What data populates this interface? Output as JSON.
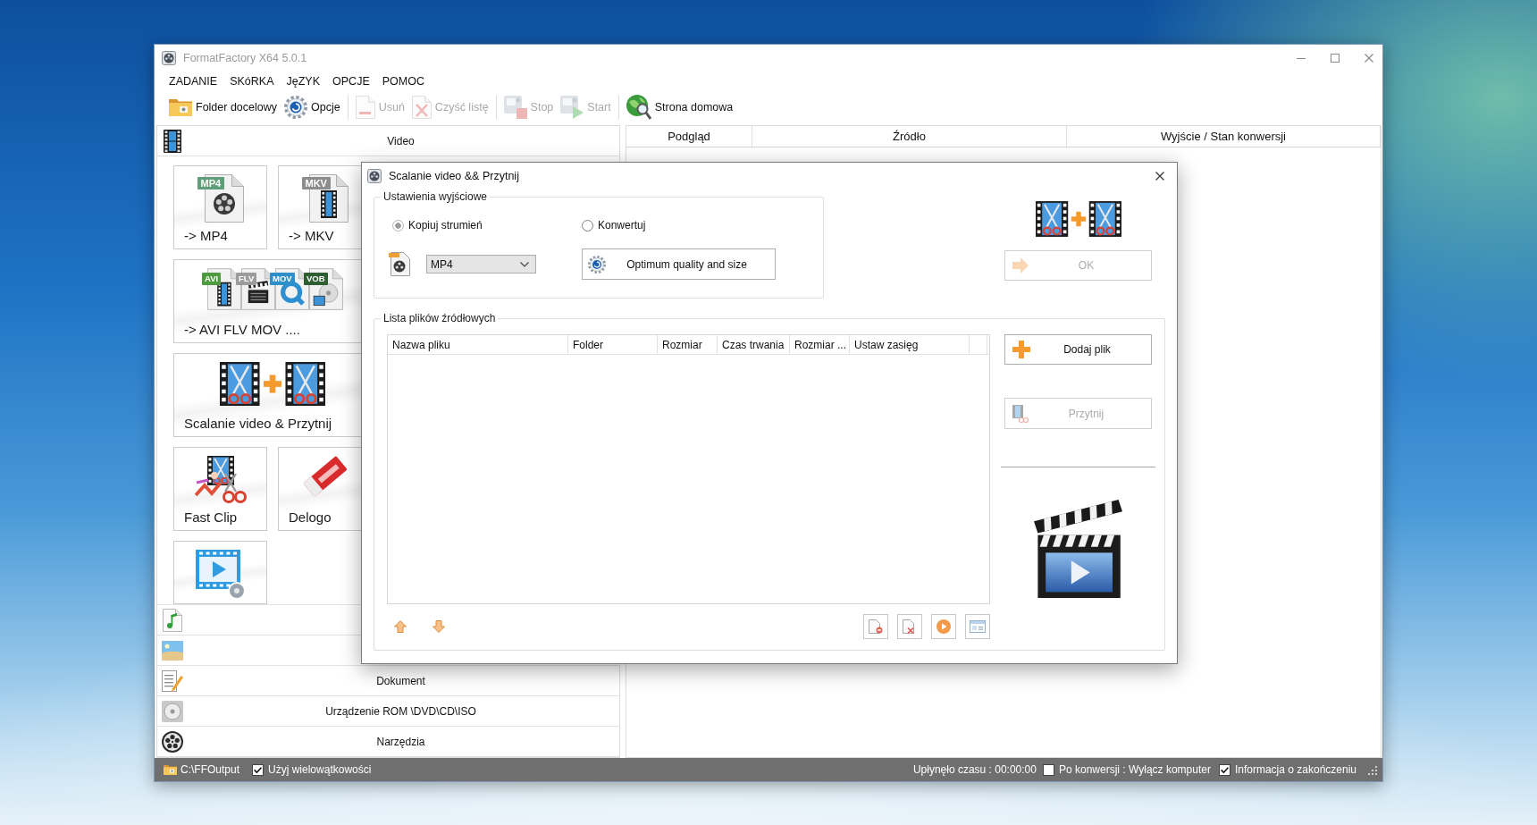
{
  "window": {
    "title": "FormatFactory X64 5.0.1"
  },
  "menu": [
    "ZADANIE",
    "SKóRKA",
    "JęZYK",
    "OPCJE",
    "POMOC"
  ],
  "toolbar": [
    {
      "items": [
        {
          "kind": "folder",
          "label": "Folder docelowy",
          "disabled": false
        },
        {
          "kind": "options",
          "label": "Opcje",
          "disabled": false
        }
      ]
    },
    {
      "items": [
        {
          "kind": "remove",
          "label": "Usuń",
          "disabled": true
        },
        {
          "kind": "clear",
          "label": "Czyść listę",
          "disabled": true
        }
      ]
    },
    {
      "items": [
        {
          "kind": "stop",
          "label": "Stop",
          "disabled": true
        },
        {
          "kind": "start",
          "label": "Start",
          "disabled": true
        }
      ]
    },
    {
      "items": [
        {
          "kind": "home",
          "label": "Strona domowa",
          "disabled": false
        }
      ]
    }
  ],
  "sidebar": {
    "categories": [
      {
        "kind": "video",
        "label": "Video",
        "tiles": [
          {
            "kind": "mp4",
            "label": "-> MP4",
            "badges": [
              {
                "text": "MP4",
                "color": "#5e9e78"
              }
            ]
          },
          {
            "kind": "mkv",
            "label": "-> MKV",
            "badges": [
              {
                "text": "MKV",
                "color": "#8c8c8c"
              }
            ]
          },
          {
            "kind": "multi",
            "label": "-> AVI FLV MOV ....",
            "badges": [
              {
                "text": "AVI",
                "color": "#4e9a3e"
              },
              {
                "text": "FLV",
                "color": "#9c9c9c"
              },
              {
                "text": "MOV",
                "color": "#2f8fcb"
              },
              {
                "text": "VOB",
                "color": "#2f5e30"
              }
            ]
          },
          {
            "kind": "merge",
            "label": "Scalanie video & Przytnij"
          },
          {
            "kind": "fastclip",
            "label": "Fast Clip"
          },
          {
            "kind": "delogo",
            "label": "Delogo"
          },
          {
            "kind": "player"
          }
        ]
      },
      {
        "kind": "audio"
      },
      {
        "kind": "picture"
      },
      {
        "kind": "document",
        "label": "Dokument"
      },
      {
        "kind": "rom",
        "label": "Urządzenie ROM \\DVD\\CD\\ISO"
      },
      {
        "kind": "tools",
        "label": "Narzędzia"
      }
    ]
  },
  "main_table": {
    "columns": [
      "Podgląd",
      "Źródło",
      "Wyjście / Stan konwersji"
    ]
  },
  "dialog": {
    "title": "Scalanie video && Przytnij",
    "output_settings": {
      "title": "Ustawienia wyjściowe",
      "modes": [
        {
          "label": "Kopiuj strumień",
          "selected": true
        },
        {
          "label": "Konwertuj",
          "selected": false
        }
      ],
      "format": {
        "value": "MP4",
        "disabled": true
      },
      "quality_button": {
        "label": "Optimum quality and size"
      }
    },
    "ok_button": {
      "label": "OK",
      "disabled": true
    },
    "source_files": {
      "title": "Lista plików źródłowych",
      "columns": [
        "Nazwa pliku",
        "Folder",
        "Rozmiar",
        "Czas trwania",
        "Rozmiar ...",
        "Ustaw zasięg"
      ]
    },
    "add_button": {
      "label": "Dodaj plik",
      "disabled": false
    },
    "trim_button": {
      "label": "Przytnij",
      "disabled": true
    }
  },
  "status_bar": {
    "output_folder": "C:\\FFOutput",
    "multithread": {
      "label": "Użyj wielowątkowości",
      "checked": true
    },
    "elapsed": "Upłynęło czasu : 00:00:00",
    "shutdown": {
      "label": "Po konwersji : Wyłącz komputer",
      "checked": false
    },
    "notify": {
      "label": "Informacja o zakończeniu",
      "checked": true
    }
  }
}
